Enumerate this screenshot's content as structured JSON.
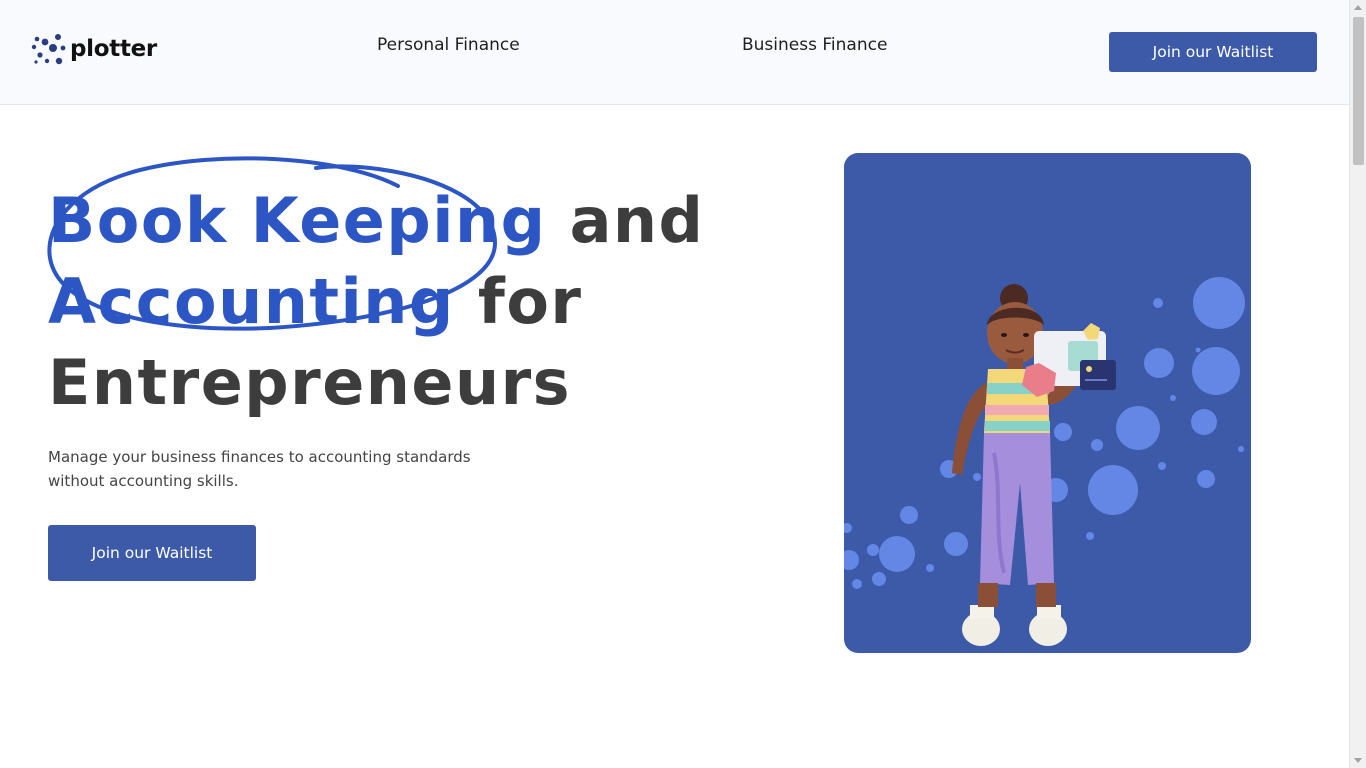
{
  "brand": {
    "name": "plotter",
    "logo_icon": "dots-logo-icon",
    "accent_color": "#3c5aa8",
    "highlight_color": "#2c56c4"
  },
  "nav": {
    "items": [
      {
        "label": "Personal Finance"
      },
      {
        "label": "Business Finance"
      }
    ],
    "cta_label": "Join our Waitlist"
  },
  "hero": {
    "title_highlight_1": "Book Keeping",
    "title_rest_1": " and",
    "title_highlight_2": "Accounting",
    "title_rest_2": " for",
    "title_line_3": "Entrepreneurs",
    "subtitle": "Manage your business finances to accounting standards without accounting skills.",
    "cta_label": "Join our Waitlist",
    "illustration": "woman-with-tablet-illustration"
  }
}
